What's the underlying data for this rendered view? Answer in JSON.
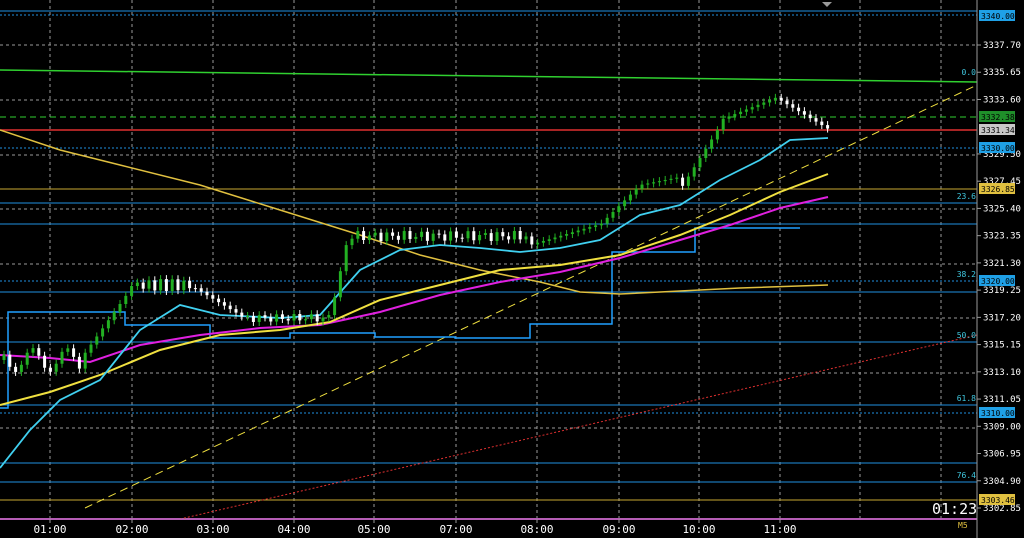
{
  "chart_data": {
    "type": "candlestick",
    "timeframe": "M5",
    "countdown": "01:23",
    "y_ticks": [
      "3337.70",
      "3335.65",
      "3333.60",
      "3329.50",
      "3327.45",
      "3325.40",
      "3323.35",
      "3321.30",
      "3319.25",
      "3317.20",
      "3315.15",
      "3313.10",
      "3311.05",
      "3309.00",
      "3306.95",
      "3304.90",
      "3302.85"
    ],
    "x_ticks": [
      "01:00",
      "02:00",
      "03:00",
      "04:00",
      "05:00",
      "07:00",
      "08:00",
      "09:00",
      "10:00",
      "11:00"
    ],
    "price_badges": [
      {
        "text": "3340.00",
        "bg": "#1fa0e6"
      },
      {
        "text": "3332.38",
        "bg": "#1f8f2a"
      },
      {
        "text": "3331.34",
        "bg": "#c8c8c8"
      },
      {
        "text": "3330.00",
        "bg": "#1fa0e6"
      },
      {
        "text": "3326.85",
        "bg": "#e0c040"
      },
      {
        "text": "3320.00",
        "bg": "#1fa0e6"
      },
      {
        "text": "3310.00",
        "bg": "#1fa0e6"
      },
      {
        "text": "3303.46",
        "bg": "#e0c040"
      }
    ],
    "fib_labels": [
      "0.0",
      "23.6",
      "38.2",
      "50.0",
      "61.8",
      "76.4"
    ],
    "colors": {
      "bull": "#22b022",
      "bear": "#ffffff",
      "grid": "#9a9a9a",
      "ma_fast": "#40d0f0",
      "ma_mid": "#f0e040",
      "ma_slow": "#e020e0",
      "ma_long": "#e0c040",
      "horizontal_blue": "#2090e0",
      "horizontal_gold": "#c8a832",
      "resistance_red": "#e03030",
      "green_line": "#30d030",
      "donchian": "#20a0ff",
      "purple": "#d020d0"
    }
  }
}
